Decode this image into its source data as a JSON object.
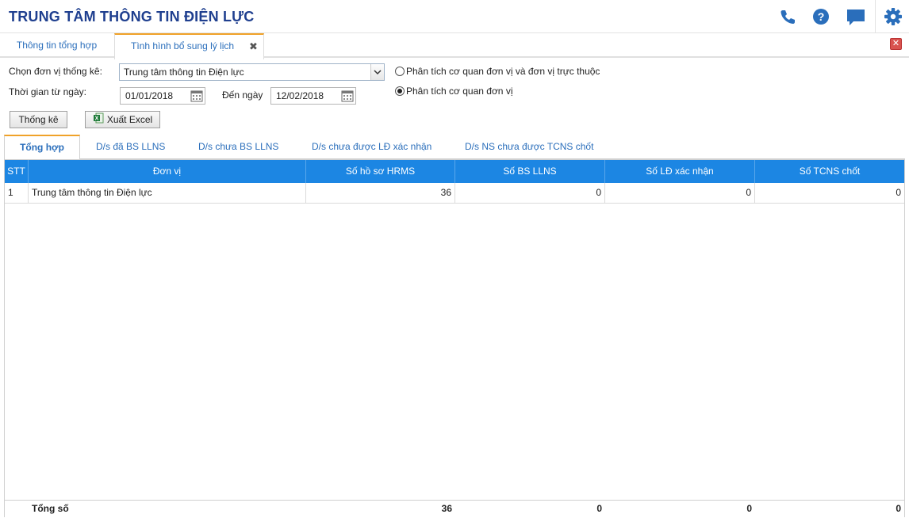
{
  "app": {
    "title": "TRUNG TÂM THÔNG TIN ĐIỆN LỰC"
  },
  "header_icons": [
    "phone-icon",
    "help-icon",
    "chat-icon",
    "settings-icon"
  ],
  "colors": {
    "brand": "#1f3f8f",
    "link": "#2a6ebb",
    "accent": "#f0a229",
    "grid_header": "#1c86e3"
  },
  "main_tabs": [
    {
      "label": "Thông tin tổng hợp"
    },
    {
      "label": "Tình hình bổ sung lý lịch"
    }
  ],
  "form": {
    "unit_label": "Chọn đơn vị thống kê:",
    "unit_value": "Trung tâm thông tin Điện lực",
    "from_label": "Thời gian từ ngày:",
    "from_value": "01/01/2018",
    "to_label": "Đến ngày",
    "to_value": "12/02/2018",
    "radio_1": "Phân tích cơ quan đơn vị và đơn vị trực thuộc",
    "radio_2": "Phân tích cơ quan đơn vị",
    "selected_radio": 2,
    "stat_button": "Thống kê",
    "excel_button": "Xuất Excel"
  },
  "sub_tabs": [
    {
      "label": "Tổng hợp"
    },
    {
      "label": "D/s đã BS LLNS"
    },
    {
      "label": "D/s chưa BS LLNS"
    },
    {
      "label": "D/s chưa được LĐ xác nhận"
    },
    {
      "label": "D/s NS chưa được TCNS chốt"
    }
  ],
  "table": {
    "columns": [
      "STT",
      "Đơn vị",
      "Số hồ sơ HRMS",
      "Số BS LLNS",
      "Số LĐ xác nhận",
      "Số TCNS chốt"
    ],
    "rows": [
      {
        "stt": "1",
        "unit": "Trung tâm thông tin Điện lực",
        "hrms": "36",
        "bs": "0",
        "ld": "0",
        "tcns": "0"
      }
    ],
    "footer": {
      "label": "Tổng số",
      "hrms": "36",
      "bs": "0",
      "ld": "0",
      "tcns": "0"
    }
  }
}
